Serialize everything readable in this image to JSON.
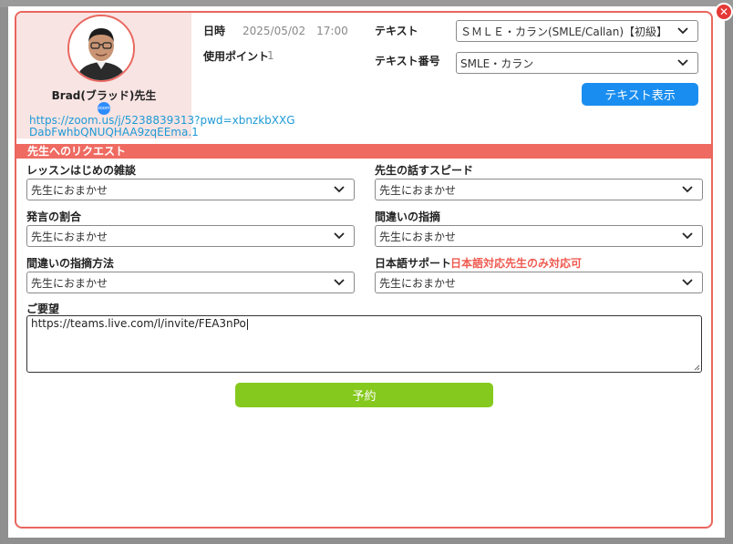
{
  "teacher": {
    "name": "Brad(ブラッド)先生",
    "zoom_icon_label": "zoom",
    "zoom_link": "https://zoom.us/j/5238839313?pwd=xbnzkbXXGDabFwhbQNUQHAA9zqEEma.1"
  },
  "lesson": {
    "datetime_label": "日時",
    "datetime_value": "2025/05/02　17:00",
    "points_label": "使用ポイント",
    "points_value": "1",
    "text_label": "テキスト",
    "text_value": "ＳＭＬＥ・カラン(SMLE/Callan)【初級】",
    "text_number_label": "テキスト番号",
    "text_number_value": "SMLE・カラン",
    "show_text_button": "テキスト表示"
  },
  "request": {
    "section_title": "先生へのリクエスト",
    "small_talk_label": "レッスンはじめの雑談",
    "small_talk_value": "先生におまかせ",
    "speed_label": "先生の話すスピード",
    "speed_value": "先生におまかせ",
    "speaking_ratio_label": "発言の割合",
    "speaking_ratio_value": "先生におまかせ",
    "correction_label": "間違いの指摘",
    "correction_value": "先生におまかせ",
    "correction_method_label": "間違いの指摘方法",
    "correction_method_value": "先生におまかせ",
    "japanese_support_label": "日本語サポート",
    "japanese_support_note": "日本語対応先生のみ対応可",
    "japanese_support_value": "先生におまかせ",
    "wishes_label": "ご要望",
    "wishes_value": "https://teams.live.com/l/invite/FEA3nPo"
  },
  "actions": {
    "reserve_button": "予約",
    "close_icon": "close-icon"
  },
  "colors": {
    "accent": "#ef6b62",
    "primary_button": "#1a8ef0",
    "reserve_button": "#86c91e",
    "link": "#1e9ad6",
    "note": "#ef5a50"
  }
}
